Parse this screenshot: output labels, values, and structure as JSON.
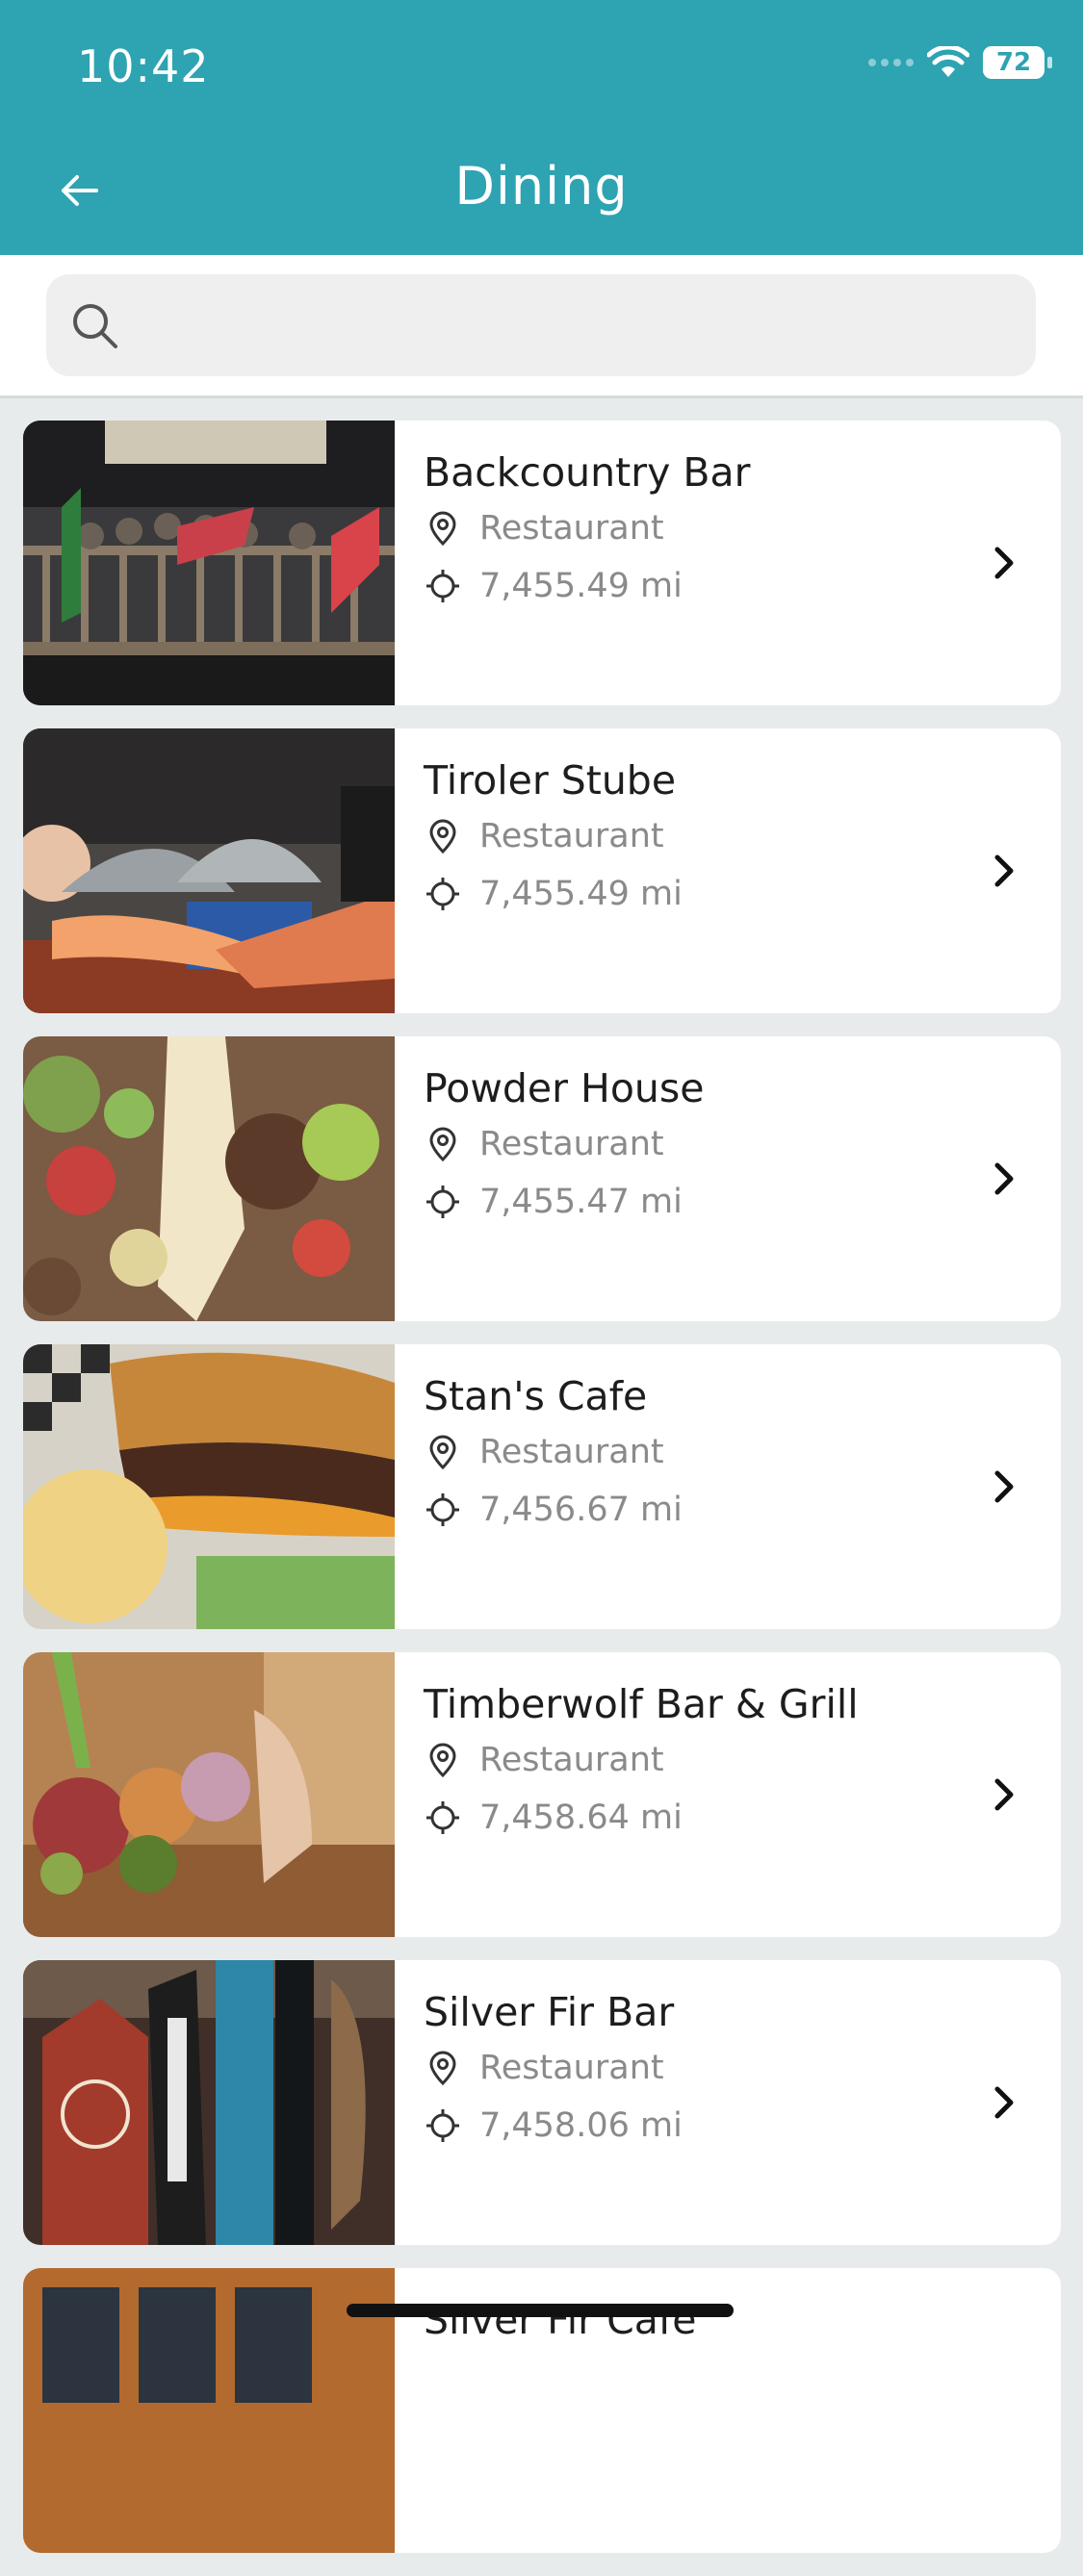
{
  "status_bar": {
    "time": "10:42",
    "battery": "72"
  },
  "header": {
    "title": "Dining"
  },
  "search": {
    "placeholder": "",
    "value": ""
  },
  "places": [
    {
      "name": "Backcountry Bar",
      "category": "Restaurant",
      "distance": "7,455.49 mi"
    },
    {
      "name": "Tiroler Stube",
      "category": "Restaurant",
      "distance": "7,455.49 mi"
    },
    {
      "name": "Powder House",
      "category": "Restaurant",
      "distance": "7,455.47 mi"
    },
    {
      "name": "Stan's Cafe",
      "category": "Restaurant",
      "distance": "7,456.67 mi"
    },
    {
      "name": "Timberwolf Bar & Grill",
      "category": "Restaurant",
      "distance": "7,458.64 mi"
    },
    {
      "name": "Silver Fir Bar",
      "category": "Restaurant",
      "distance": "7,458.06 mi"
    },
    {
      "name": "Silver Fir Cafe",
      "category": "",
      "distance": ""
    }
  ],
  "colors": {
    "header": "#2ea3b2",
    "background": "#e8ebec"
  },
  "icons": {
    "back": "arrow-left-icon",
    "search": "search-icon",
    "category": "location-pin-icon",
    "distance": "crosshair-icon",
    "chevron": "chevron-right-icon"
  }
}
